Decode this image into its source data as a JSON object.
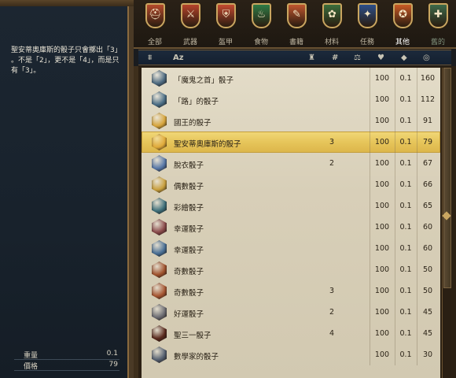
{
  "description": "聖安蒂奧庫斯的骰子只會擲出「3」\n。不是「2」，更不是「4」，而是只\n有「3」。",
  "stats": {
    "weight_label": "重量",
    "weight_value": "0.1",
    "price_label": "價格",
    "price_value": "79"
  },
  "tabs": [
    {
      "label": "全部",
      "icon": "helmet-icon",
      "color": "#b44a2c",
      "glyph": "⛑"
    },
    {
      "label": "武器",
      "icon": "weapons-icon",
      "color": "#b5432a",
      "glyph": "⚔"
    },
    {
      "label": "盔甲",
      "icon": "armor-icon",
      "color": "#c44a30",
      "glyph": "⛨"
    },
    {
      "label": "食物",
      "icon": "food-icon",
      "color": "#2f7a45",
      "glyph": "♨"
    },
    {
      "label": "書籍",
      "icon": "book-icon",
      "color": "#c0552e",
      "glyph": "✎"
    },
    {
      "label": "材料",
      "icon": "materials-icon",
      "color": "#3b6d3c",
      "glyph": "✿"
    },
    {
      "label": "任務",
      "icon": "quest-icon",
      "color": "#2c4f8a",
      "glyph": "✦"
    },
    {
      "label": "其他",
      "icon": "misc-icon",
      "color": "#c95a25",
      "glyph": "✪"
    },
    {
      "label": "舊的",
      "icon": "old-icon",
      "color": "#3d6a4a",
      "glyph": "✚"
    }
  ],
  "active_tab": 7,
  "columns": {
    "filter": "filter-icon",
    "sort_az": "Az",
    "type": "item-type-icon",
    "quantity": "#",
    "durability": "durability-icon",
    "value": "value-icon",
    "weight": "weight-icon",
    "price": "price-icon"
  },
  "items": [
    {
      "name": "「魔鬼之首」骰子",
      "qty": "",
      "w": "100",
      "wt": "0.1",
      "price": "160",
      "color": "#4d6a80"
    },
    {
      "name": "「路」的骰子",
      "qty": "",
      "w": "100",
      "wt": "0.1",
      "price": "112",
      "color": "#4a6d85"
    },
    {
      "name": "國王的骰子",
      "qty": "",
      "w": "100",
      "wt": "0.1",
      "price": "91",
      "color": "#d7a53c"
    },
    {
      "name": "聖安蒂奧庫斯的骰子",
      "qty": "3",
      "w": "100",
      "wt": "0.1",
      "price": "79",
      "color": "#e0aa3a"
    },
    {
      "name": "脫衣骰子",
      "qty": "2",
      "w": "100",
      "wt": "0.1",
      "price": "67",
      "color": "#5878a8"
    },
    {
      "name": "偶數骰子",
      "qty": "",
      "w": "100",
      "wt": "0.1",
      "price": "66",
      "color": "#c9a03e"
    },
    {
      "name": "彩繪骰子",
      "qty": "",
      "w": "100",
      "wt": "0.1",
      "price": "65",
      "color": "#3e6f7a"
    },
    {
      "name": "幸運骰子",
      "qty": "",
      "w": "100",
      "wt": "0.1",
      "price": "60",
      "color": "#8a4a4a"
    },
    {
      "name": "幸運骰子",
      "qty": "",
      "w": "100",
      "wt": "0.1",
      "price": "60",
      "color": "#4a6f95"
    },
    {
      "name": "奇數骰子",
      "qty": "",
      "w": "100",
      "wt": "0.1",
      "price": "50",
      "color": "#a0522d"
    },
    {
      "name": "奇數骰子",
      "qty": "3",
      "w": "100",
      "wt": "0.1",
      "price": "50",
      "color": "#a65632"
    },
    {
      "name": "好運骰子",
      "qty": "2",
      "w": "100",
      "wt": "0.1",
      "price": "45",
      "color": "#6c6c72"
    },
    {
      "name": "聖三一骰子",
      "qty": "4",
      "w": "100",
      "wt": "0.1",
      "price": "45",
      "color": "#5a2a1e"
    },
    {
      "name": "數學家的骰子",
      "qty": "",
      "w": "100",
      "wt": "0.1",
      "price": "30",
      "color": "#556070"
    }
  ],
  "selected_index": 3
}
